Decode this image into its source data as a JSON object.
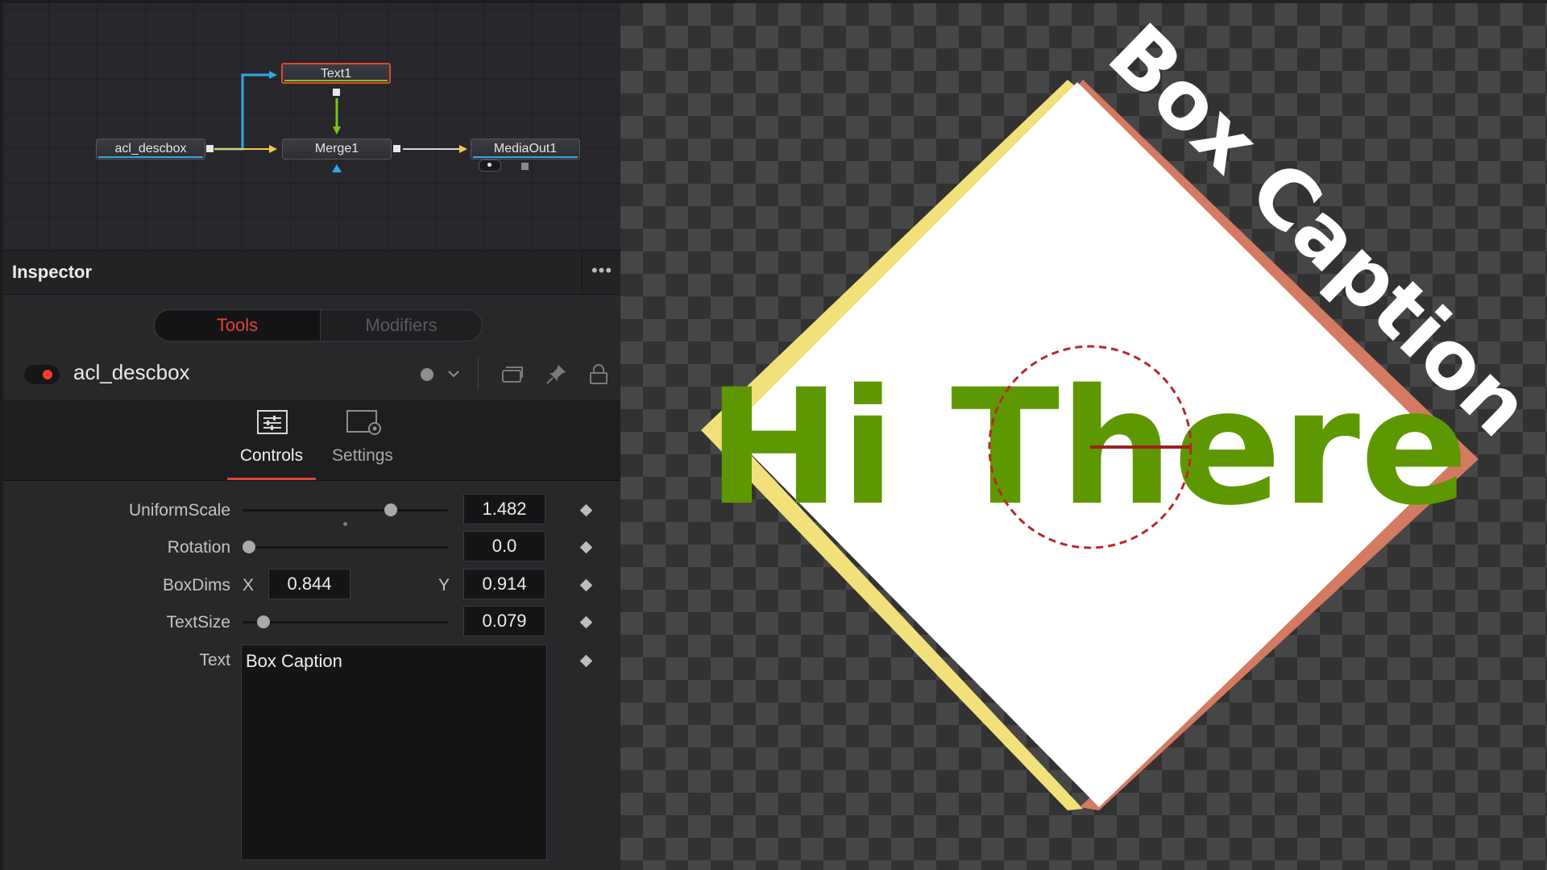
{
  "node_editor": {
    "nodes": {
      "text1": "Text1",
      "acl_descbox": "acl_descbox",
      "merge1": "Merge1",
      "mediaout1": "MediaOut1"
    },
    "colors": {
      "selected_border": "#e0453b",
      "link_blue": "#2fa8e8",
      "link_green": "#7cc41e",
      "link_yellow": "#f2c94c",
      "link_white": "#e8e8e8"
    }
  },
  "inspector": {
    "title": "Inspector",
    "menu": "•••",
    "tabs": {
      "tools": "Tools",
      "modifiers": "Modifiers"
    },
    "tool_name": "acl_descbox",
    "sub_tabs": {
      "controls": "Controls",
      "settings": "Settings"
    },
    "params": {
      "uniform_scale": {
        "label": "UniformScale",
        "value": "1.482",
        "slider_fraction": 0.72
      },
      "rotation": {
        "label": "Rotation",
        "value": "0.0",
        "slider_fraction": 0.03
      },
      "box_dims": {
        "label": "BoxDims",
        "x_label": "X",
        "x_value": "0.844",
        "y_label": "Y",
        "y_value": "0.914"
      },
      "text_size": {
        "label": "TextSize",
        "value": "0.079",
        "slider_fraction": 0.1
      },
      "text": {
        "label": "Text",
        "value": "Box Caption"
      }
    }
  },
  "viewer": {
    "main_text": "Hi There",
    "caption_text": "Box Caption",
    "colors": {
      "box_fill": "#ffffff",
      "left_edge": "#f2e07a",
      "right_edge": "#d57a62",
      "text_green": "#5e9800",
      "caption": "#ffffff",
      "center_circle": "#b8292a"
    }
  }
}
